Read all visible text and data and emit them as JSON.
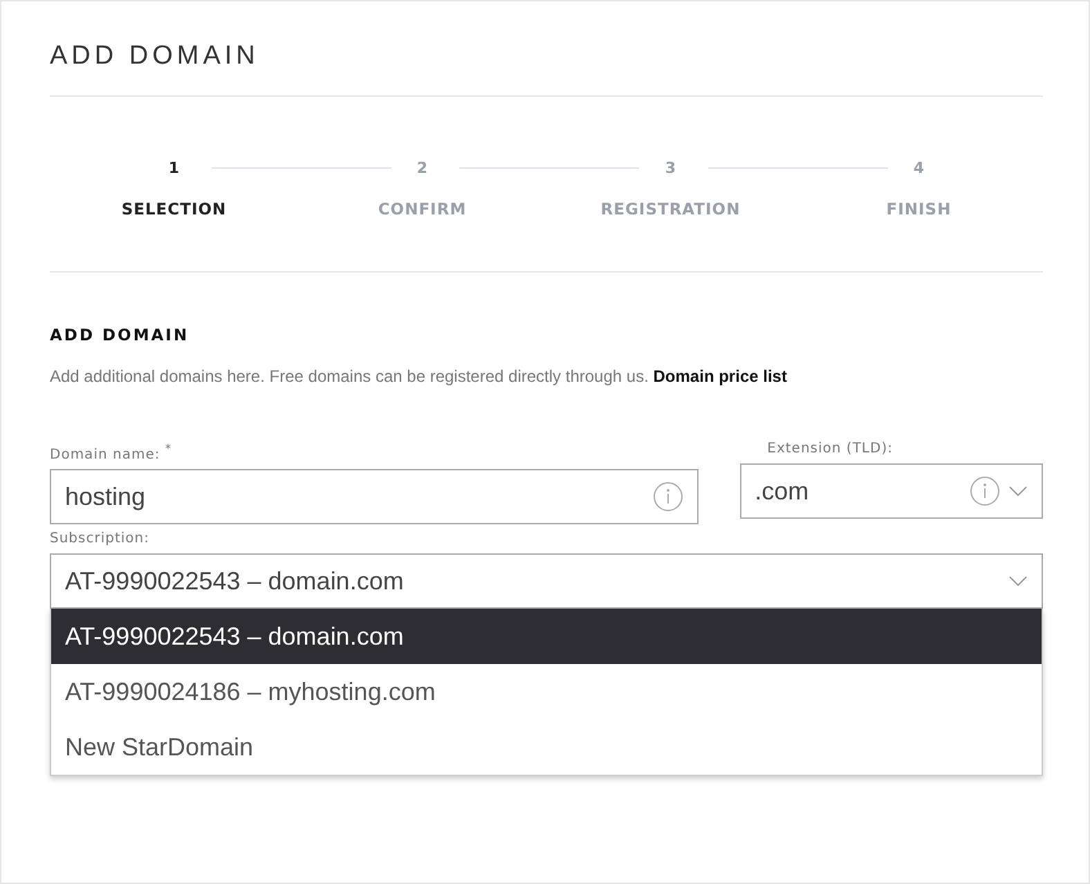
{
  "title": "ADD DOMAIN",
  "steps": [
    {
      "number": "1",
      "label": "SELECTION",
      "selected": true
    },
    {
      "number": "2",
      "label": "CONFIRM",
      "selected": false
    },
    {
      "number": "3",
      "label": "REGISTRATION",
      "selected": false
    },
    {
      "number": "4",
      "label": "FINISH",
      "selected": false
    }
  ],
  "section": {
    "heading": "ADD DOMAIN",
    "description": "Add additional domains here. Free domains can be registered directly through us.",
    "link": "Domain price list"
  },
  "domain_field": {
    "label": "Domain name:",
    "required_mark": "*",
    "value": "hosting"
  },
  "extension_field": {
    "label": "Extension (TLD):",
    "value": ".com"
  },
  "subscription": {
    "label": "Subscription:",
    "value": "AT-9990022543 – domain.com",
    "expanded": true,
    "options": [
      {
        "label": "AT-9990022543 – domain.com",
        "selected": true
      },
      {
        "label": "AT-9990024186 – myhosting.com",
        "selected": false
      },
      {
        "label": "New StarDomain",
        "selected": false
      }
    ]
  }
}
